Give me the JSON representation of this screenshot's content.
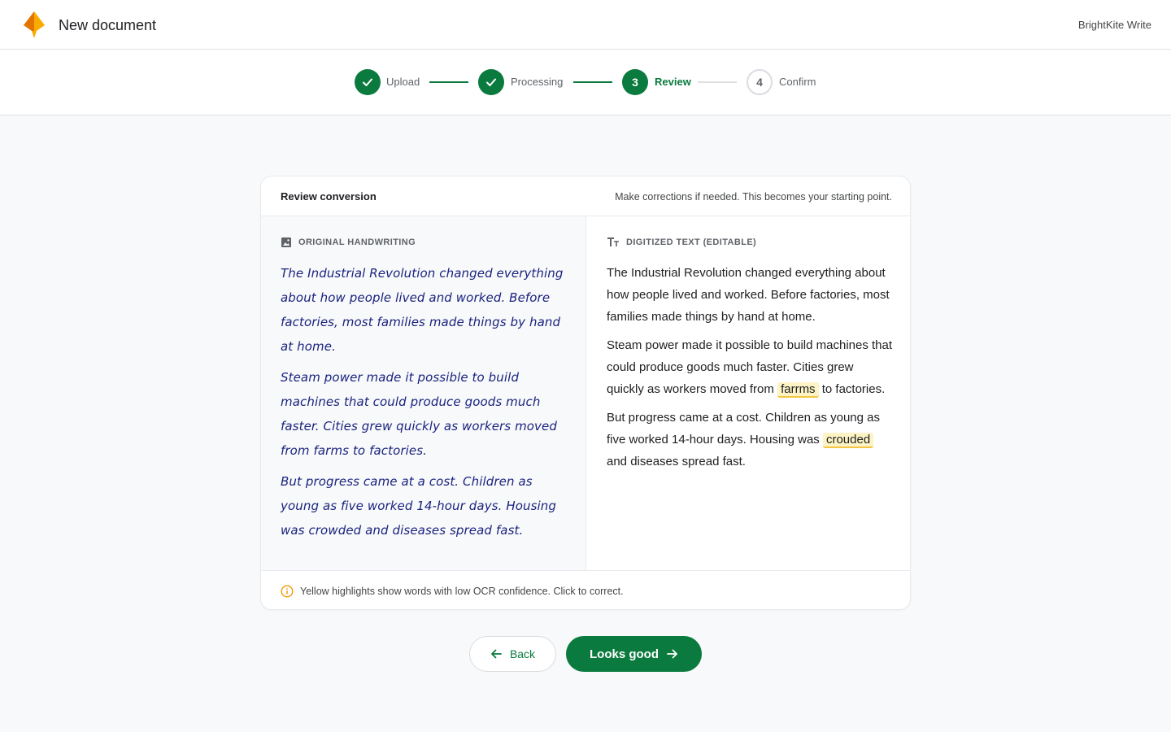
{
  "header": {
    "title": "New document",
    "brand": "BrightKite Write"
  },
  "stepper": {
    "steps": [
      {
        "label": "Upload",
        "state": "done",
        "marker": ""
      },
      {
        "label": "Processing",
        "state": "done",
        "marker": ""
      },
      {
        "label": "Review",
        "state": "active",
        "marker": "3"
      },
      {
        "label": "Confirm",
        "state": "pending",
        "marker": "4"
      }
    ]
  },
  "card": {
    "title": "Review conversion",
    "subtitle": "Make corrections if needed. This becomes your starting point.",
    "original": {
      "label": "ORIGINAL HANDWRITING",
      "icon": "image-icon",
      "paragraphs": [
        "The Industrial Revolution changed everything about how people lived and worked. Before factories, most families made things by hand at home.",
        "Steam power made it possible to build machines that could produce goods much faster. Cities grew quickly as workers moved from farms to factories.",
        "But progress came at a cost. Children as young as five worked 14-hour days. Housing was crowded and diseases spread fast."
      ]
    },
    "digitized": {
      "label": "DIGITIZED TEXT (EDITABLE)",
      "icon": "text-format-icon",
      "p1": "The Industrial Revolution changed everything about how people lived and worked. Before factories, most families made things by hand at home.",
      "p2_before": "Steam power made it possible to build machines that could produce goods much faster. Cities grew quickly as workers moved from ",
      "p2_flag": "farrms",
      "p2_after": " to factories.",
      "p3_before": "But progress came at a cost. Children as young as five worked 14-hour days. Housing was ",
      "p3_flag": "crouded",
      "p3_after": " and diseases spread fast."
    },
    "footer_note": "Yellow highlights show words with low OCR confidence. Click to correct."
  },
  "actions": {
    "back_label": "Back",
    "primary_label": "Looks good"
  },
  "colors": {
    "accent": "#0a7a3e",
    "highlight": "#fdf3c4",
    "highlight_border": "#f4c542",
    "handwriting": "#1a237e",
    "info_icon": "#f29900"
  }
}
